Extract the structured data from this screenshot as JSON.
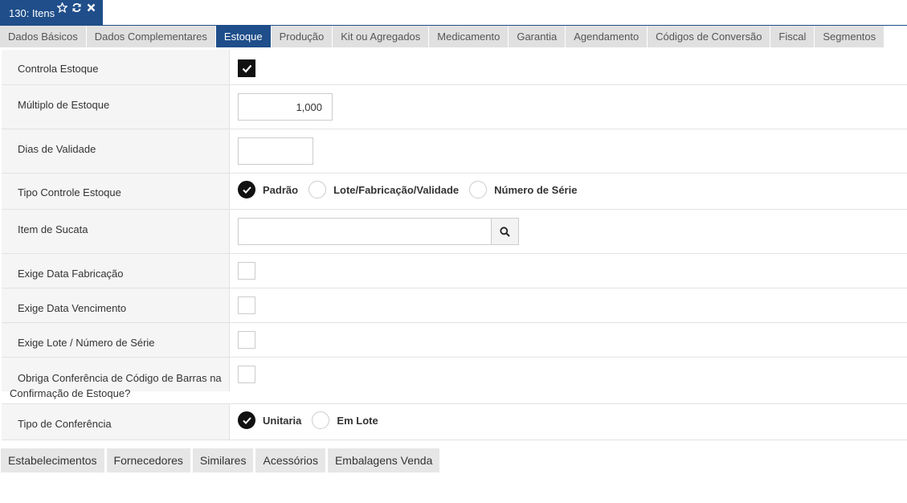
{
  "window": {
    "title": "130: Itens",
    "icons": [
      "star-icon",
      "refresh-icon",
      "close-icon"
    ]
  },
  "tabs": [
    {
      "label": "Dados Básicos"
    },
    {
      "label": "Dados Complementares"
    },
    {
      "label": "Estoque"
    },
    {
      "label": "Produção"
    },
    {
      "label": "Kit ou Agregados"
    },
    {
      "label": "Medicamento"
    },
    {
      "label": "Garantia"
    },
    {
      "label": "Agendamento"
    },
    {
      "label": "Códigos de Conversão"
    },
    {
      "label": "Fiscal"
    },
    {
      "label": "Segmentos"
    }
  ],
  "active_tab": "Estoque",
  "form": {
    "controla_estoque": {
      "label": "Controla Estoque",
      "checked": true
    },
    "multiplo_estoque": {
      "label": "Múltiplo de Estoque",
      "value": "1,000"
    },
    "dias_validade": {
      "label": "Dias de Validade",
      "value": ""
    },
    "tipo_controle": {
      "label": "Tipo Controle Estoque",
      "options": [
        "Padrão",
        "Lote/Fabricação/Validade",
        "Número de Série"
      ],
      "selected": "Padrão"
    },
    "item_sucata": {
      "label": "Item de Sucata",
      "value": ""
    },
    "exige_data_fabricacao": {
      "label": "Exige Data Fabricação",
      "checked": false
    },
    "exige_data_vencimento": {
      "label": "Exige Data Vencimento",
      "checked": false
    },
    "exige_lote": {
      "label": "Exige Lote / Número de Série",
      "checked": false
    },
    "obriga_conferencia": {
      "label": "Obriga Conferência de Código de Barras na Confirmação de Estoque?",
      "checked": false
    },
    "tipo_conferencia": {
      "label": "Tipo de Conferência",
      "options": [
        "Unitaria",
        "Em Lote"
      ],
      "selected": "Unitaria"
    }
  },
  "bottom_tabs": [
    {
      "label": "Estabelecimentos"
    },
    {
      "label": "Fornecedores"
    },
    {
      "label": "Similares"
    },
    {
      "label": "Acessórios"
    },
    {
      "label": "Embalagens Venda"
    }
  ],
  "colors": {
    "accent": "#1f4e8a",
    "tab_bg": "#e0e0e0",
    "label_bg": "#f5f5f5"
  }
}
